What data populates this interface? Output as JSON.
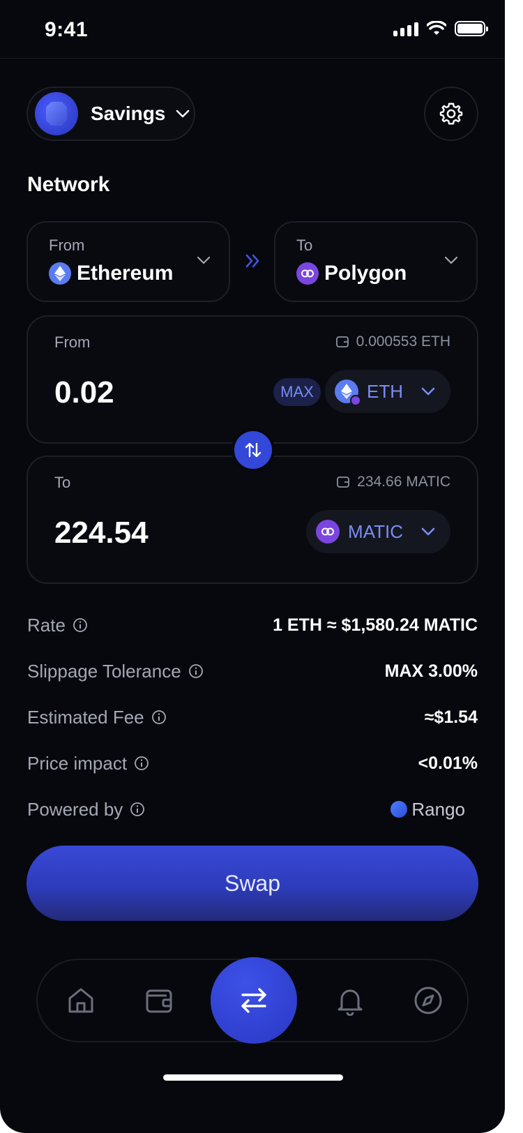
{
  "status_bar": {
    "time": "9:41"
  },
  "header": {
    "account_name": "Savings"
  },
  "network": {
    "title": "Network",
    "from": {
      "label": "From",
      "name": "Ethereum",
      "icon": "ethereum-icon"
    },
    "to": {
      "label": "To",
      "name": "Polygon",
      "icon": "polygon-icon"
    }
  },
  "from_card": {
    "label": "From",
    "balance": "0.000553 ETH",
    "amount": "0.02",
    "max_label": "MAX",
    "token": "ETH"
  },
  "to_card": {
    "label": "To",
    "balance": "234.66 MATIC",
    "amount": "224.54",
    "token": "MATIC"
  },
  "details": {
    "rate_label": "Rate",
    "rate_value": "1 ETH ≈ $1,580.24 MATIC",
    "slippage_label": "Slippage Tolerance",
    "slippage_value": "MAX 3.00%",
    "fee_label": "Estimated Fee",
    "fee_value": "≈$1.54",
    "impact_label": "Price impact",
    "impact_value": "<0.01%",
    "powered_label": "Powered by",
    "powered_value": "Rango"
  },
  "swap_button": {
    "label": "Swap"
  },
  "nav": {
    "items": [
      "home-icon",
      "wallet-icon",
      "swap-icon",
      "bell-icon",
      "compass-icon"
    ]
  },
  "colors": {
    "accent": "#3347d8",
    "background": "#07080d",
    "muted": "#a4a8b5",
    "token_text": "#7b8cf5"
  }
}
